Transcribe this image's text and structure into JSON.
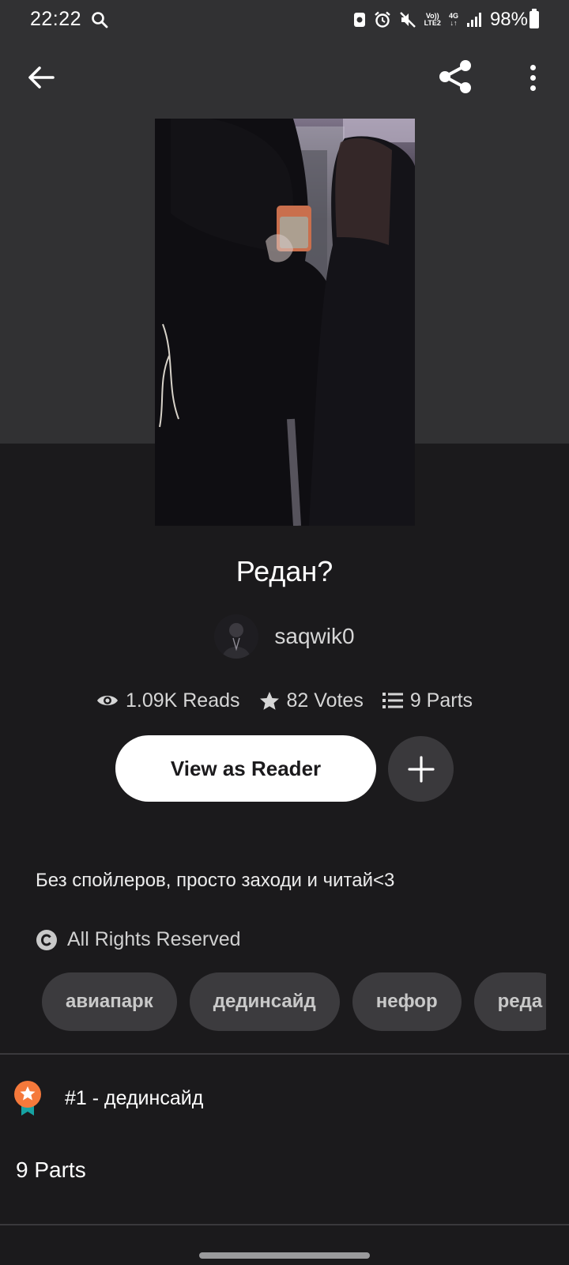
{
  "status_bar": {
    "time": "22:22",
    "battery": "98%",
    "volte_label": "Vo))",
    "lte_label": "LTE2",
    "network_label": "4G"
  },
  "toolbar": {
    "back_icon": "arrow-left-icon",
    "share_icon": "share-icon",
    "more_icon": "more-vertical-icon"
  },
  "story": {
    "title": "Редан?",
    "author": "saqwik0",
    "reads": "1.09K Reads",
    "votes": "82 Votes",
    "parts": "9 Parts",
    "view_button": "View as Reader",
    "description": "Без спойлеров, просто заходи и читай<3",
    "copyright": "All Rights Reserved",
    "tags": [
      "авиапарк",
      "дединсайд",
      "нефор",
      "реда"
    ],
    "rank": "#1 - дединсайд",
    "parts_heading": "9 Parts"
  },
  "colors": {
    "background": "#1b1a1c",
    "hero_background": "#313133",
    "tag_background": "#3c3b3e",
    "rank_badge": "#f5793b",
    "rank_ribbon": "#16a3a3"
  }
}
